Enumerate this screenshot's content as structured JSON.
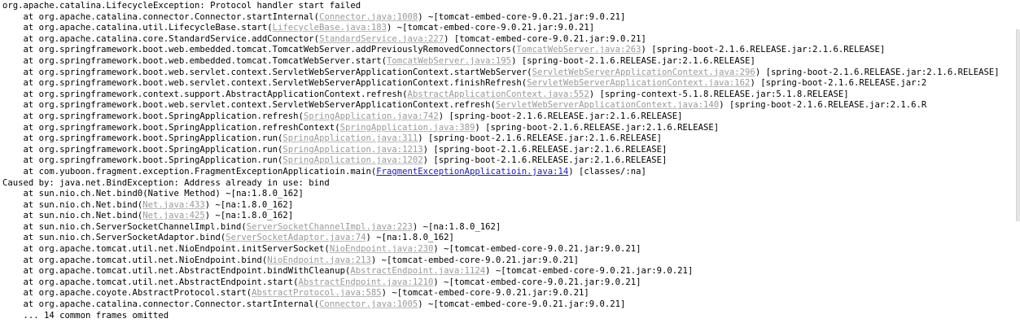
{
  "log": {
    "lines": [
      [
        {
          "t": "org.apache.catalina.LifecycleException: Protocol handler start failed"
        }
      ],
      [
        {
          "t": "    at org.apache.catalina.connector.Connector.startInternal("
        },
        {
          "t": "Connector.java:1008",
          "link": "grey"
        },
        {
          "t": ") ~[tomcat-embed-core-9.0.21.jar:9.0.21]"
        }
      ],
      [
        {
          "t": "    at org.apache.catalina.util.LifecycleBase.start("
        },
        {
          "t": "LifecycleBase.java:183",
          "link": "grey"
        },
        {
          "t": ") ~[tomcat-embed-core-9.0.21.jar:9.0.21]"
        }
      ],
      [
        {
          "t": "    at org.apache.catalina.core.StandardService.addConnector("
        },
        {
          "t": "StandardService.java:227",
          "link": "grey"
        },
        {
          "t": ") [tomcat-embed-core-9.0.21.jar:9.0.21]"
        }
      ],
      [
        {
          "t": "    at org.springframework.boot.web.embedded.tomcat.TomcatWebServer.addPreviouslyRemovedConnectors("
        },
        {
          "t": "TomcatWebServer.java:263",
          "link": "grey"
        },
        {
          "t": ") [spring-boot-2.1.6.RELEASE.jar:2.1.6.RELEASE]"
        }
      ],
      [
        {
          "t": "    at org.springframework.boot.web.embedded.tomcat.TomcatWebServer.start("
        },
        {
          "t": "TomcatWebServer.java:195",
          "link": "grey"
        },
        {
          "t": ") [spring-boot-2.1.6.RELEASE.jar:2.1.6.RELEASE]"
        }
      ],
      [
        {
          "t": "    at org.springframework.boot.web.servlet.context.ServletWebServerApplicationContext.startWebServer("
        },
        {
          "t": "ServletWebServerApplicationContext.java:296",
          "link": "grey"
        },
        {
          "t": ") [spring-boot-2.1.6.RELEASE.jar:2.1.6.RELEASE]"
        }
      ],
      [
        {
          "t": "    at org.springframework.boot.web.servlet.context.ServletWebServerApplicationContext.finishRefresh("
        },
        {
          "t": "ServletWebServerApplicationContext.java:162",
          "link": "grey"
        },
        {
          "t": ") [spring-boot-2.1.6.RELEASE.jar:2"
        }
      ],
      [
        {
          "t": "    at org.springframework.context.support.AbstractApplicationContext.refresh("
        },
        {
          "t": "AbstractApplicationContext.java:552",
          "link": "grey"
        },
        {
          "t": ") [spring-context-5.1.8.RELEASE.jar:5.1.8.RELEASE]"
        }
      ],
      [
        {
          "t": "    at org.springframework.boot.web.servlet.context.ServletWebServerApplicationContext.refresh("
        },
        {
          "t": "ServletWebServerApplicationContext.java:140",
          "link": "grey"
        },
        {
          "t": ") [spring-boot-2.1.6.RELEASE.jar:2.1.6.R"
        }
      ],
      [
        {
          "t": "    at org.springframework.boot.SpringApplication.refresh("
        },
        {
          "t": "SpringApplication.java:742",
          "link": "grey"
        },
        {
          "t": ") [spring-boot-2.1.6.RELEASE.jar:2.1.6.RELEASE]"
        }
      ],
      [
        {
          "t": "    at org.springframework.boot.SpringApplication.refreshContext("
        },
        {
          "t": "SpringApplication.java:389",
          "link": "grey"
        },
        {
          "t": ") [spring-boot-2.1.6.RELEASE.jar:2.1.6.RELEASE]"
        }
      ],
      [
        {
          "t": "    at org.springframework.boot.SpringApplication.run("
        },
        {
          "t": "SpringApplication.java:311",
          "link": "grey"
        },
        {
          "t": ") [spring-boot-2.1.6.RELEASE.jar:2.1.6.RELEASE]"
        }
      ],
      [
        {
          "t": "    at org.springframework.boot.SpringApplication.run("
        },
        {
          "t": "SpringApplication.java:1213",
          "link": "grey"
        },
        {
          "t": ") [spring-boot-2.1.6.RELEASE.jar:2.1.6.RELEASE]"
        }
      ],
      [
        {
          "t": "    at org.springframework.boot.SpringApplication.run("
        },
        {
          "t": "SpringApplication.java:1202",
          "link": "grey"
        },
        {
          "t": ") [spring-boot-2.1.6.RELEASE.jar:2.1.6.RELEASE]"
        }
      ],
      [
        {
          "t": "    at com.yuboon.fragment.exception.FragmentExceptionApplicatioin.main("
        },
        {
          "t": "FragmentExceptionApplicatioin.java:14",
          "link": "blue"
        },
        {
          "t": ") [classes/:na]"
        }
      ],
      [
        {
          "t": "Caused by: java.net.BindException: Address already in use: bind"
        }
      ],
      [
        {
          "t": "    at sun.nio.ch.Net.bind0(Native Method) ~[na:1.8.0_162]"
        }
      ],
      [
        {
          "t": "    at sun.nio.ch.Net.bind("
        },
        {
          "t": "Net.java:433",
          "link": "grey"
        },
        {
          "t": ") ~[na:1.8.0_162]"
        }
      ],
      [
        {
          "t": "    at sun.nio.ch.Net.bind("
        },
        {
          "t": "Net.java:425",
          "link": "grey"
        },
        {
          "t": ") ~[na:1.8.0_162]"
        }
      ],
      [
        {
          "t": "    at sun.nio.ch.ServerSocketChannelImpl.bind("
        },
        {
          "t": "ServerSocketChannelImpl.java:223",
          "link": "grey"
        },
        {
          "t": ") ~[na:1.8.0_162]"
        }
      ],
      [
        {
          "t": "    at sun.nio.ch.ServerSocketAdaptor.bind("
        },
        {
          "t": "ServerSocketAdaptor.java:74",
          "link": "grey"
        },
        {
          "t": ") ~[na:1.8.0_162]"
        }
      ],
      [
        {
          "t": "    at org.apache.tomcat.util.net.NioEndpoint.initServerSocket("
        },
        {
          "t": "NioEndpoint.java:230",
          "link": "grey"
        },
        {
          "t": ") ~[tomcat-embed-core-9.0.21.jar:9.0.21]"
        }
      ],
      [
        {
          "t": "    at org.apache.tomcat.util.net.NioEndpoint.bind("
        },
        {
          "t": "NioEndpoint.java:213",
          "link": "grey"
        },
        {
          "t": ") ~[tomcat-embed-core-9.0.21.jar:9.0.21]"
        }
      ],
      [
        {
          "t": "    at org.apache.tomcat.util.net.AbstractEndpoint.bindWithCleanup("
        },
        {
          "t": "AbstractEndpoint.java:1124",
          "link": "grey"
        },
        {
          "t": ") ~[tomcat-embed-core-9.0.21.jar:9.0.21]"
        }
      ],
      [
        {
          "t": "    at org.apache.tomcat.util.net.AbstractEndpoint.start("
        },
        {
          "t": "AbstractEndpoint.java:1210",
          "link": "grey"
        },
        {
          "t": ") ~[tomcat-embed-core-9.0.21.jar:9.0.21]"
        }
      ],
      [
        {
          "t": "    at org.apache.coyote.AbstractProtocol.start("
        },
        {
          "t": "AbstractProtocol.java:585",
          "link": "grey"
        },
        {
          "t": ") ~[tomcat-embed-core-9.0.21.jar:9.0.21]"
        }
      ],
      [
        {
          "t": "    at org.apache.catalina.connector.Connector.startInternal("
        },
        {
          "t": "Connector.java:1005",
          "link": "grey"
        },
        {
          "t": ") ~[tomcat-embed-core-9.0.21.jar:9.0.21]"
        }
      ],
      [
        {
          "t": "    ... 14 common frames omitted"
        }
      ]
    ]
  },
  "colors": {
    "background": "#ffffff",
    "text": "#000000",
    "source_link": "#9a9a9a",
    "project_link": "#1a1ab8"
  }
}
